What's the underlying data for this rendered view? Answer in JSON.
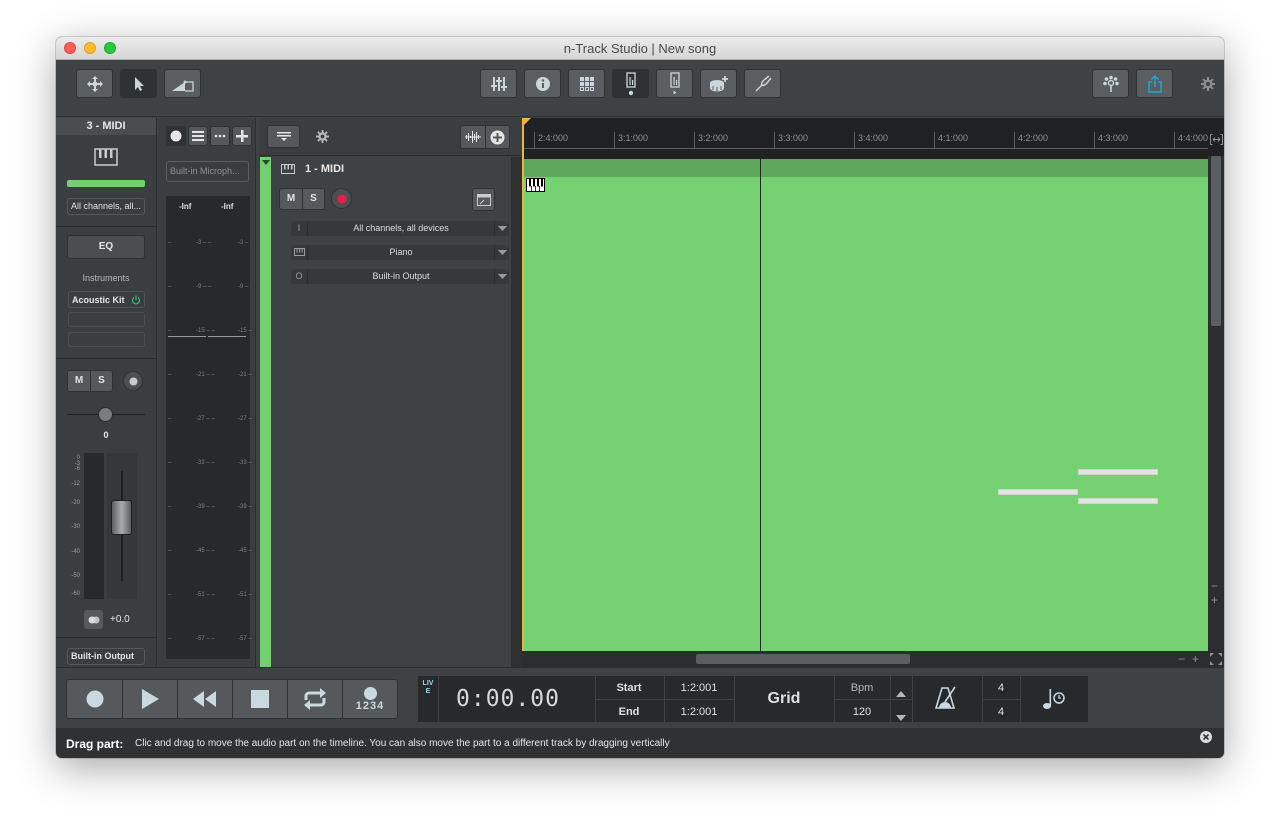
{
  "window": {
    "title": "n-Track Studio | New song"
  },
  "toolbar": {
    "left_tools": [
      {
        "name": "move-tool",
        "icon": "move-arrows-icon"
      },
      {
        "name": "select-tool",
        "icon": "pointer-arrow-icon",
        "active": true
      },
      {
        "name": "volume-envelope-tool",
        "icon": "ramp-envelope-icon"
      }
    ],
    "center_tools": [
      {
        "name": "mixer",
        "icon": "mixer-sliders-icon"
      },
      {
        "name": "info",
        "icon": "info-icon"
      },
      {
        "name": "step-sequencer",
        "icon": "grid-pads-icon"
      },
      {
        "name": "tracks-view",
        "icon": "track-view-dot-icon",
        "active": true
      },
      {
        "name": "piano-roll-view",
        "icon": "track-view-play-icon"
      },
      {
        "name": "add-drum-track",
        "icon": "drum-plus-icon"
      },
      {
        "name": "tuner",
        "icon": "tuning-fork-icon"
      }
    ],
    "right_tools": [
      {
        "name": "songtree",
        "icon": "songtree-icon"
      },
      {
        "name": "share",
        "icon": "share-upload-icon",
        "color": "#1fa5d8"
      }
    ],
    "settings_icon": "gear-icon"
  },
  "channel_strip": {
    "title": "3 - MIDI",
    "input_label": "All channels, all...",
    "eq_label": "EQ",
    "instruments_label": "Instruments",
    "instrument": "Acoustic Kit",
    "mute_label": "M",
    "solo_label": "S",
    "pan_value": "0",
    "volume_value": "+0.0",
    "output_label": "Built-in Output",
    "db_scale": [
      "0",
      "-3",
      "-6",
      "-12",
      "-20",
      "-30",
      "-40",
      "-50",
      "-60"
    ],
    "level_color": "#73d06e"
  },
  "input_meter": {
    "input_device": "Built-in Microph...",
    "left_peak": "-Inf",
    "right_peak": "-Inf",
    "ticks": [
      "-3",
      "-9",
      "-15",
      "-21",
      "-27",
      "-33",
      "-39",
      "-45",
      "-51",
      "-57"
    ]
  },
  "tracks_panel": {
    "track": {
      "name": "1 - MIDI",
      "mute_label": "M",
      "solo_label": "S",
      "color": "#73d06e",
      "input": {
        "icon_text": "I",
        "label": "All channels, all devices"
      },
      "instrument": {
        "label": "Piano"
      },
      "output": {
        "icon_text": "O",
        "label": "Built-in Output"
      }
    }
  },
  "timeline": {
    "ruler_labels": [
      "2:4:000",
      "3:1:000",
      "3:2:000",
      "3:3:000",
      "3:4:000",
      "4:1:000",
      "4:2:000",
      "4:3:000",
      "4:4:000"
    ],
    "clip_color": "#76d173"
  },
  "transport": {
    "live_label": "LIVE",
    "time": "0:00.00",
    "start_label": "Start",
    "start_value": "1:2:001",
    "end_label": "End",
    "end_value": "1:2:001",
    "grid_label": "Grid",
    "bpm_label": "Bpm",
    "bpm_value": "120",
    "time_sig_top": "4",
    "time_sig_bottom": "4",
    "countin_label": "1234"
  },
  "status": {
    "title": "Drag part:",
    "text": "Clic and drag to move the audio part on the timeline. You can also move the part to a different track by dragging vertically"
  }
}
